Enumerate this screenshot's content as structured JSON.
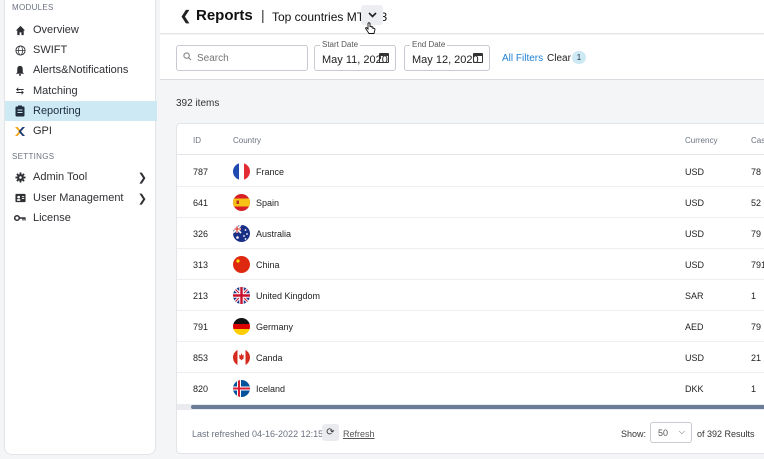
{
  "sidebar": {
    "modules_title": "MODULES",
    "settings_title": "SETTINGS",
    "items": [
      {
        "label": "Overview",
        "icon": "home-icon"
      },
      {
        "label": "SWIFT",
        "icon": "globe-icon"
      },
      {
        "label": "Alerts&Notifications",
        "icon": "bell-icon"
      },
      {
        "label": "Matching",
        "icon": "swap-icon"
      },
      {
        "label": "Reporting",
        "icon": "clipboard-icon",
        "active": true
      },
      {
        "label": "GPI",
        "icon": "gpi-icon"
      }
    ],
    "settings": [
      {
        "label": "Admin Tool",
        "icon": "gear-icon"
      },
      {
        "label": "User Management",
        "icon": "users-icon"
      },
      {
        "label": "License",
        "icon": "key-icon"
      }
    ]
  },
  "header": {
    "title": "Reports",
    "separator": "|",
    "subtitle": "Top countries MT 103"
  },
  "filters": {
    "search_placeholder": "Search",
    "start_date_label": "Start Date",
    "start_date_value": "May 11, 2020",
    "end_date_label": "End Date",
    "end_date_value": "May 12, 2020",
    "all_filters": "All Filters",
    "clear": "Clear",
    "clear_count": "1"
  },
  "item_count": "392 items",
  "table": {
    "columns": [
      "ID",
      "Country",
      "Currency",
      "Cas"
    ],
    "rows": [
      {
        "id": "787",
        "country": "France",
        "currency": "USD",
        "cas": "78"
      },
      {
        "id": "641",
        "country": "Spain",
        "currency": "USD",
        "cas": "52"
      },
      {
        "id": "326",
        "country": "Australia",
        "currency": "USD",
        "cas": "79"
      },
      {
        "id": "313",
        "country": "China",
        "currency": "USD",
        "cas": "791"
      },
      {
        "id": "213",
        "country": "United Kingdom",
        "currency": "SAR",
        "cas": "1"
      },
      {
        "id": "791",
        "country": "Germany",
        "currency": "AED",
        "cas": "79"
      },
      {
        "id": "853",
        "country": "Canda",
        "currency": "USD",
        "cas": "21"
      },
      {
        "id": "820",
        "country": "Iceland",
        "currency": "DKK",
        "cas": "1"
      }
    ]
  },
  "footer": {
    "last_refreshed": "Last refreshed 04-16-2022 12:15:27",
    "refresh": "Refresh",
    "show_label": "Show:",
    "page_size": "50",
    "of_results": "of 392 Results"
  },
  "colors": {
    "accent": "#1f7fd3",
    "active_bg": "#cde9f4"
  }
}
